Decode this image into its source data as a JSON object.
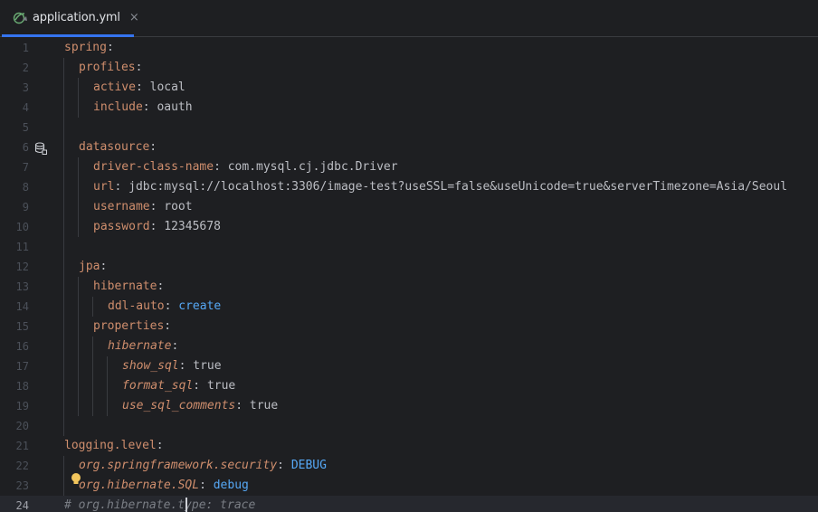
{
  "tab": {
    "filename": "application.yml",
    "close_glyph": "×",
    "icon": "spring-leaf-icon"
  },
  "colors": {
    "background": "#1e1f22",
    "key": "#cf8e6d",
    "value": "#bcbec4",
    "enum_value": "#56a8f5",
    "comment": "#7a7e85",
    "line_number": "#4b5059",
    "tab_underline": "#3574f0"
  },
  "editor": {
    "current_line": 24,
    "lines": [
      {
        "n": "1",
        "indent": 0,
        "tokens": [
          {
            "t": "spring",
            "c": "key"
          },
          {
            "t": ":",
            "c": "p"
          }
        ]
      },
      {
        "n": "2",
        "indent": 1,
        "tokens": [
          {
            "t": "profiles",
            "c": "key"
          },
          {
            "t": ":",
            "c": "p"
          }
        ]
      },
      {
        "n": "3",
        "indent": 2,
        "tokens": [
          {
            "t": "active",
            "c": "key"
          },
          {
            "t": ": ",
            "c": "p"
          },
          {
            "t": "local",
            "c": "v"
          }
        ]
      },
      {
        "n": "4",
        "indent": 2,
        "tokens": [
          {
            "t": "include",
            "c": "key"
          },
          {
            "t": ": ",
            "c": "p"
          },
          {
            "t": "oauth",
            "c": "v"
          }
        ]
      },
      {
        "n": "5",
        "indent": 0,
        "tokens": []
      },
      {
        "n": "6",
        "indent": 1,
        "tokens": [
          {
            "t": "datasource",
            "c": "key"
          },
          {
            "t": ":",
            "c": "p"
          }
        ]
      },
      {
        "n": "7",
        "indent": 2,
        "tokens": [
          {
            "t": "driver-class-name",
            "c": "key"
          },
          {
            "t": ": ",
            "c": "p"
          },
          {
            "t": "com.mysql.cj.jdbc.Driver",
            "c": "v"
          }
        ]
      },
      {
        "n": "8",
        "indent": 2,
        "tokens": [
          {
            "t": "url",
            "c": "key"
          },
          {
            "t": ": ",
            "c": "p"
          },
          {
            "t": "jdbc:mysql://localhost:3306/image-test?useSSL=false&useUnicode=true&serverTimezone=Asia/Seoul",
            "c": "v"
          }
        ]
      },
      {
        "n": "9",
        "indent": 2,
        "tokens": [
          {
            "t": "username",
            "c": "key"
          },
          {
            "t": ": ",
            "c": "p"
          },
          {
            "t": "root",
            "c": "v"
          }
        ]
      },
      {
        "n": "10",
        "indent": 2,
        "tokens": [
          {
            "t": "password",
            "c": "key"
          },
          {
            "t": ": ",
            "c": "p"
          },
          {
            "t": "12345678",
            "c": "v"
          }
        ]
      },
      {
        "n": "11",
        "indent": 0,
        "tokens": []
      },
      {
        "n": "12",
        "indent": 1,
        "tokens": [
          {
            "t": "jpa",
            "c": "key"
          },
          {
            "t": ":",
            "c": "p"
          }
        ]
      },
      {
        "n": "13",
        "indent": 2,
        "tokens": [
          {
            "t": "hibernate",
            "c": "key"
          },
          {
            "t": ":",
            "c": "p"
          }
        ]
      },
      {
        "n": "14",
        "indent": 3,
        "tokens": [
          {
            "t": "ddl-auto",
            "c": "key"
          },
          {
            "t": ": ",
            "c": "p"
          },
          {
            "t": "create",
            "c": "vb"
          }
        ]
      },
      {
        "n": "15",
        "indent": 2,
        "tokens": [
          {
            "t": "properties",
            "c": "key"
          },
          {
            "t": ":",
            "c": "p"
          }
        ]
      },
      {
        "n": "16",
        "indent": 3,
        "tokens": [
          {
            "t": "hibernate",
            "c": "keyi"
          },
          {
            "t": ":",
            "c": "p"
          }
        ]
      },
      {
        "n": "17",
        "indent": 4,
        "tokens": [
          {
            "t": "show_sql",
            "c": "keyi"
          },
          {
            "t": ": ",
            "c": "p"
          },
          {
            "t": "true",
            "c": "v"
          }
        ]
      },
      {
        "n": "18",
        "indent": 4,
        "tokens": [
          {
            "t": "format_sql",
            "c": "keyi"
          },
          {
            "t": ": ",
            "c": "p"
          },
          {
            "t": "true",
            "c": "v"
          }
        ]
      },
      {
        "n": "19",
        "indent": 4,
        "tokens": [
          {
            "t": "use_sql_comments",
            "c": "keyi"
          },
          {
            "t": ": ",
            "c": "p"
          },
          {
            "t": "true",
            "c": "v"
          }
        ]
      },
      {
        "n": "20",
        "indent": 0,
        "tokens": []
      },
      {
        "n": "21",
        "indent": 0,
        "tokens": [
          {
            "t": "logging.level",
            "c": "key"
          },
          {
            "t": ":",
            "c": "p"
          }
        ]
      },
      {
        "n": "22",
        "indent": 1,
        "tokens": [
          {
            "t": "org.springframework.security",
            "c": "keyi"
          },
          {
            "t": ": ",
            "c": "p"
          },
          {
            "t": "DEBUG",
            "c": "vb"
          }
        ]
      },
      {
        "n": "23",
        "indent": 1,
        "tokens": [
          {
            "t": "org.hibernate.SQL",
            "c": "keyi"
          },
          {
            "t": ": ",
            "c": "p"
          },
          {
            "t": "debug",
            "c": "vb"
          }
        ]
      },
      {
        "n": "24",
        "indent": 0,
        "tokens": [
          {
            "t": "# org.hibernate.type: trace",
            "c": "cm"
          }
        ]
      }
    ]
  },
  "gutter": {
    "database_marker_line": 6,
    "database_marker_icon": "database-icon",
    "bulb_line": 23,
    "bulb_icon": "lightbulb-icon"
  }
}
